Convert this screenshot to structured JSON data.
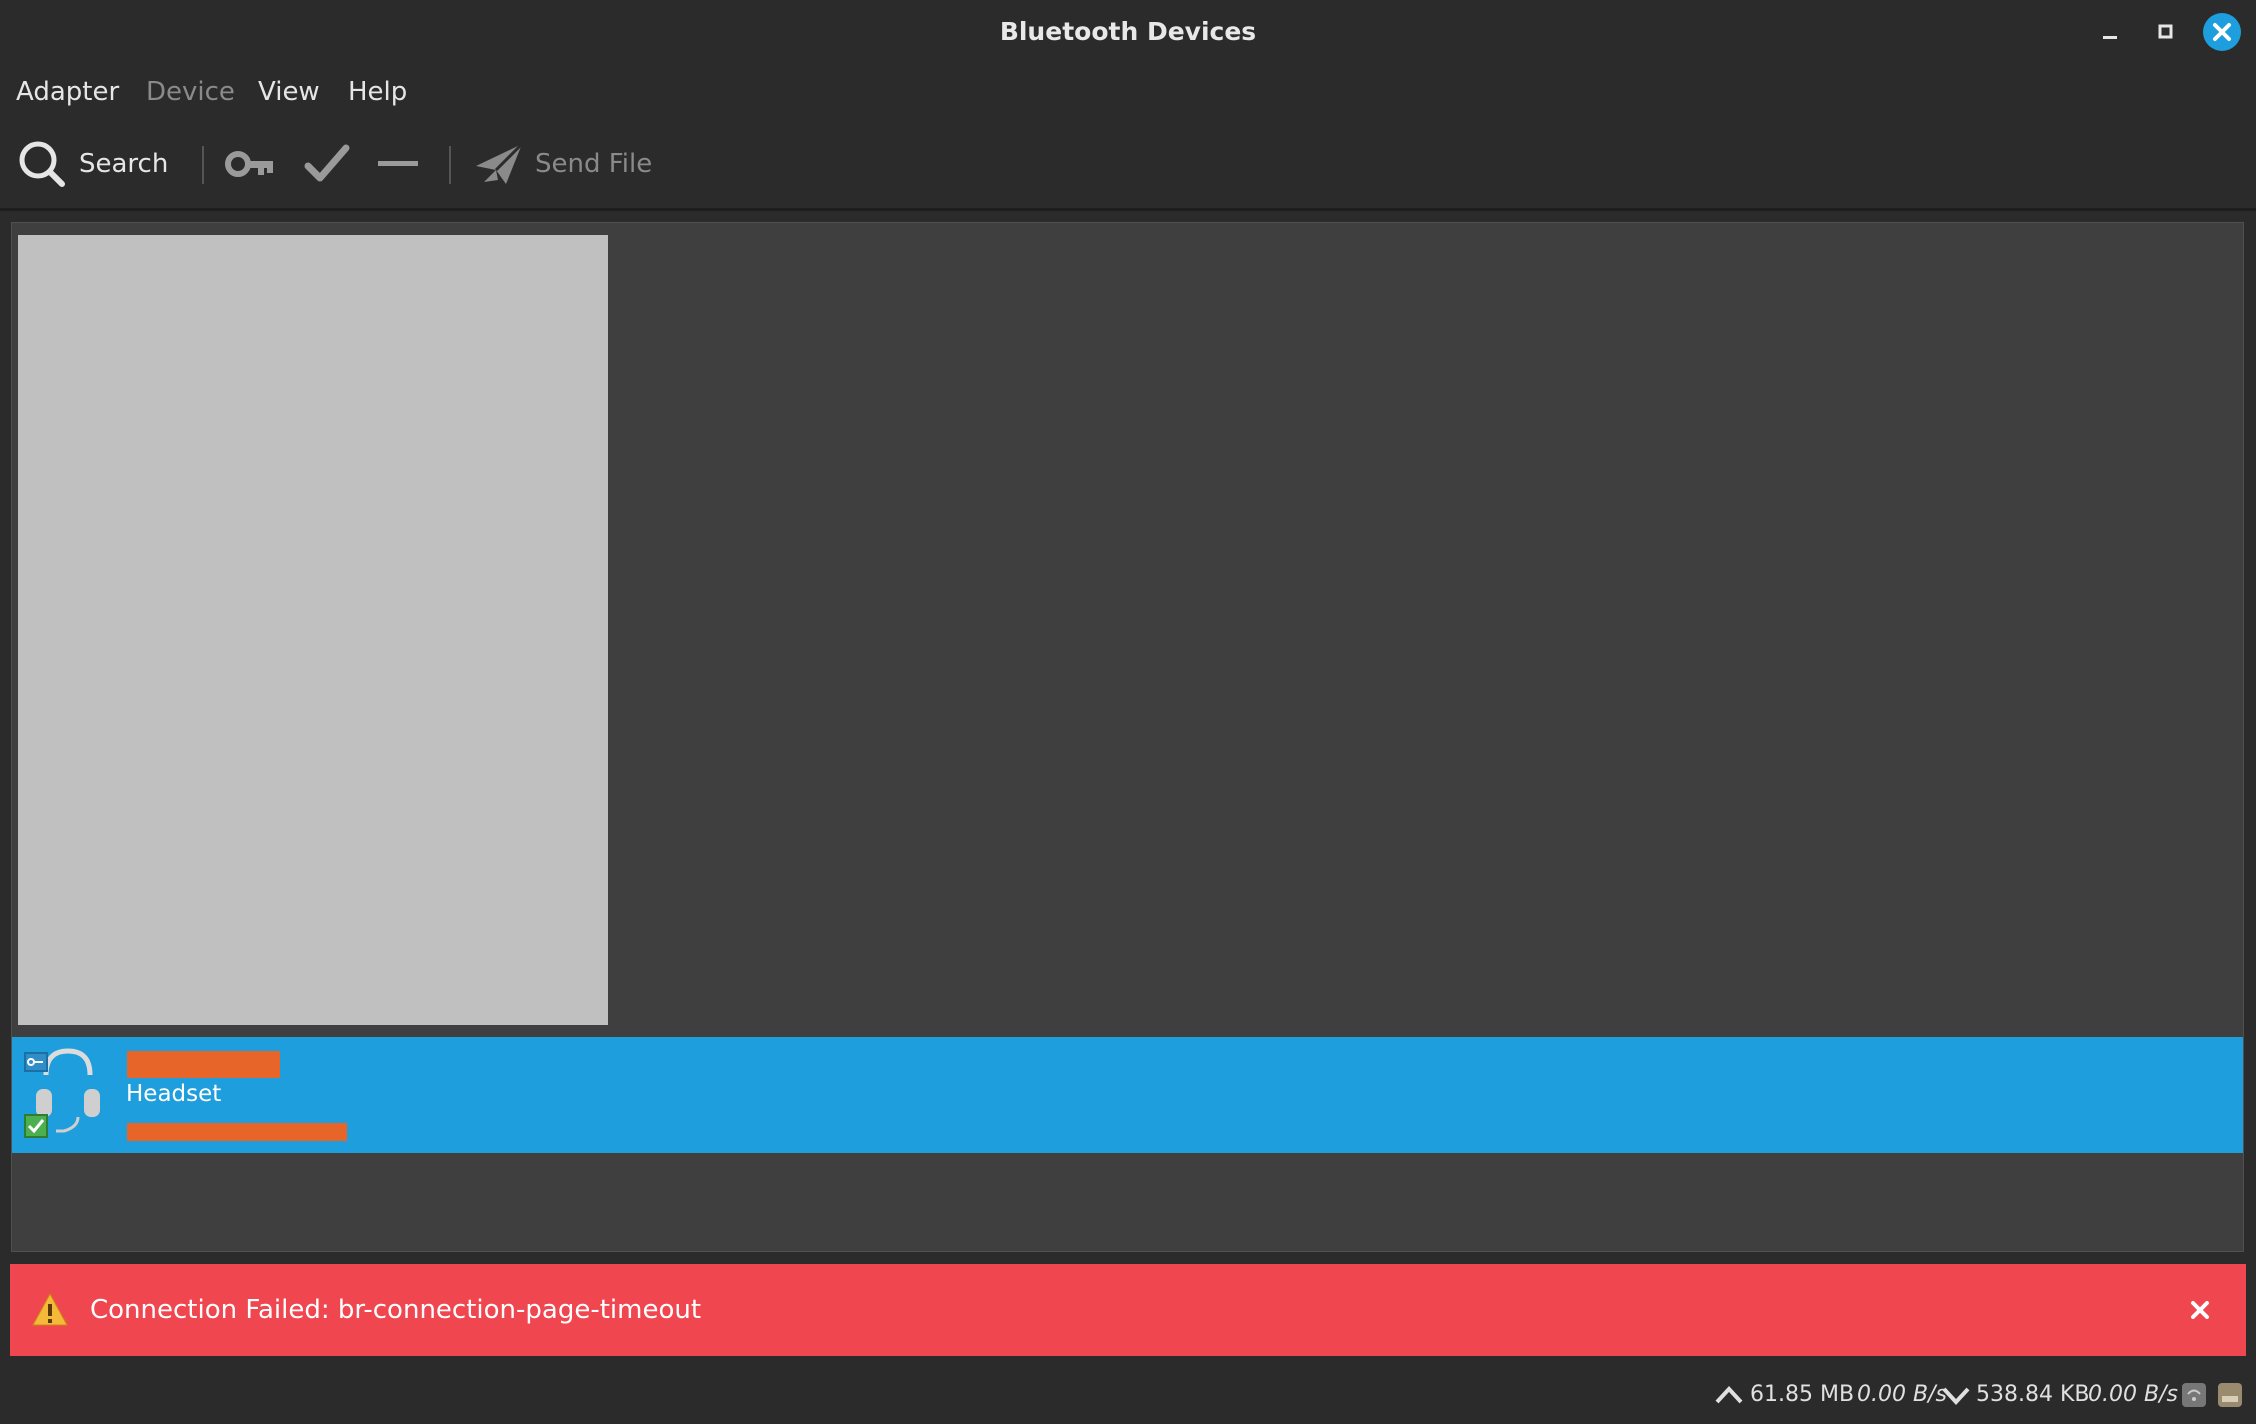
{
  "window": {
    "title": "Bluetooth Devices"
  },
  "menu": {
    "items": [
      "Adapter",
      "Device",
      "View",
      "Help"
    ]
  },
  "toolbar": {
    "search_label": "Search",
    "send_file_label": "Send File"
  },
  "device": {
    "type": "Headset"
  },
  "info_bar": {
    "message": "Connection Failed: br-connection-page-timeout"
  },
  "status": {
    "upload_total": "61.85 MB",
    "upload_rate": "0.00 B/s",
    "download_total": "538.84 KB",
    "download_rate": "0.00 B/s"
  },
  "colors": {
    "accent": "#1e9edd",
    "error": "#f0464f",
    "redaction": "#e8652a",
    "background": "#2b2b2b",
    "list_background": "#3f3f3f"
  },
  "icons": [
    "minimize-icon",
    "maximize-icon",
    "close-icon",
    "search-icon",
    "key-icon",
    "check-icon",
    "remove-icon",
    "send-icon",
    "headset-icon",
    "warning-icon",
    "dismiss-icon",
    "upload-arrow-icon",
    "download-arrow-icon",
    "network-icon",
    "storage-icon"
  ]
}
